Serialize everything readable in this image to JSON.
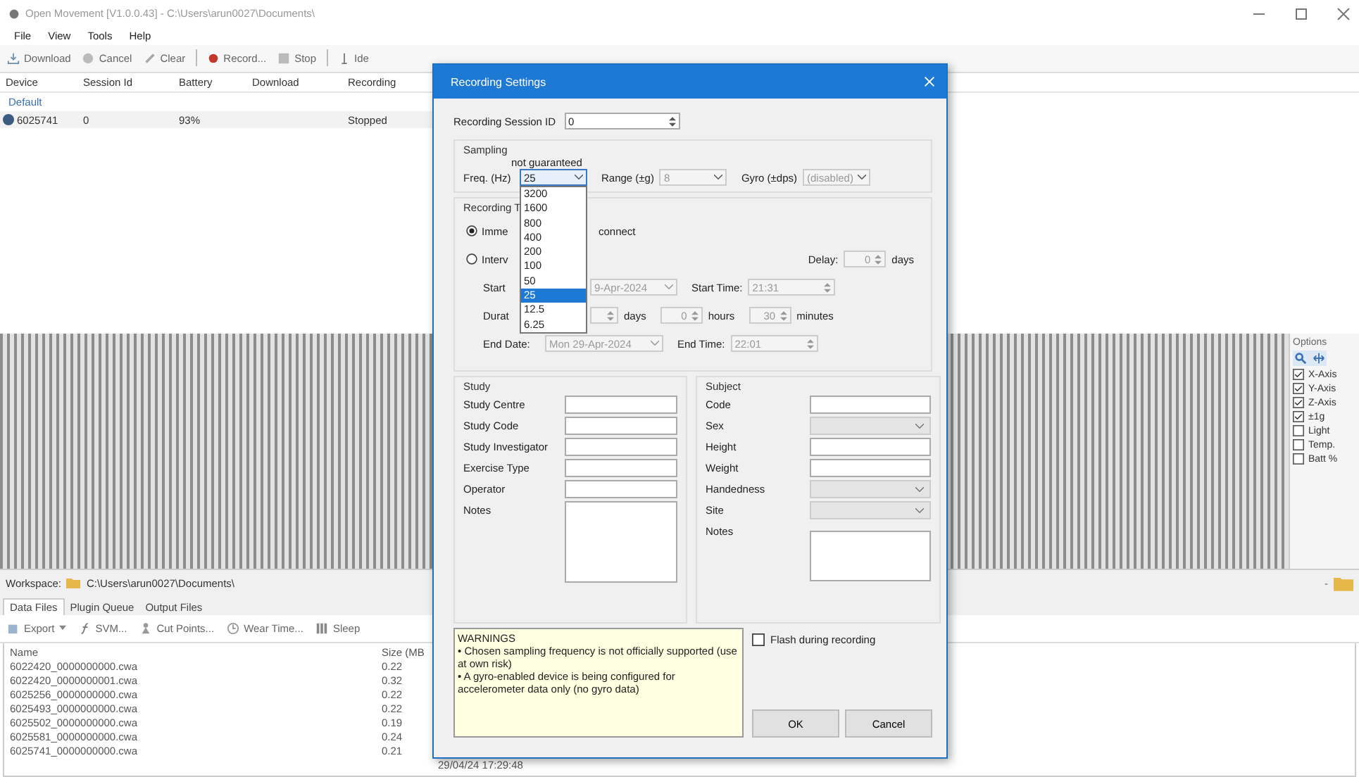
{
  "window": {
    "title": "Open Movement  [V1.0.0.43] - C:\\Users\\arun0027\\Documents\\"
  },
  "menu": [
    "File",
    "View",
    "Tools",
    "Help"
  ],
  "toolbar": [
    {
      "label": "Download"
    },
    {
      "label": "Cancel"
    },
    {
      "label": "Clear"
    },
    {
      "label": "Record..."
    },
    {
      "label": "Stop"
    },
    {
      "label": "Ide"
    }
  ],
  "devices": {
    "columns": [
      "Device",
      "Session Id",
      "Battery",
      "Download",
      "Recording"
    ],
    "group": "Default",
    "rows": [
      {
        "device": "6025741",
        "session": "0",
        "battery": "93%",
        "recording": "Stopped",
        "color": "#3d5a80"
      }
    ]
  },
  "options": {
    "title": "Options",
    "checks": [
      {
        "label": "X-Axis",
        "checked": true
      },
      {
        "label": "Y-Axis",
        "checked": true
      },
      {
        "label": "Z-Axis",
        "checked": true
      },
      {
        "label": "±1g",
        "checked": true
      },
      {
        "label": "Light",
        "checked": false
      },
      {
        "label": "Temp.",
        "checked": false
      },
      {
        "label": "Batt %",
        "checked": false
      }
    ]
  },
  "workspace": {
    "label": "Workspace:",
    "path": "C:\\Users\\arun0027\\Documents\\",
    "minus": "-"
  },
  "tabs": [
    {
      "label": "Data Files",
      "selected": true
    },
    {
      "label": "Plugin Queue",
      "selected": false
    },
    {
      "label": "Output Files",
      "selected": false
    }
  ],
  "file_toolbar": [
    {
      "label": "Export",
      "dropdown": true
    },
    {
      "label": "SVM...",
      "dropdown": false
    },
    {
      "label": "Cut Points...",
      "dropdown": false
    },
    {
      "label": "Wear Time...",
      "dropdown": false
    },
    {
      "label": "Sleep",
      "dropdown": false
    }
  ],
  "files": {
    "columns": [
      "Name",
      "Size (MB"
    ],
    "rows": [
      {
        "name": "6022420_0000000000.cwa",
        "size": "0.22"
      },
      {
        "name": "6022420_0000000001.cwa",
        "size": "0.32"
      },
      {
        "name": "6025256_0000000000.cwa",
        "size": "0.22"
      },
      {
        "name": "6025493_0000000000.cwa",
        "size": "0.22"
      },
      {
        "name": "6025502_0000000000.cwa",
        "size": "0.19"
      },
      {
        "name": "6025581_0000000000.cwa",
        "size": "0.24"
      },
      {
        "name": "6025741_0000000000.cwa",
        "size": "0.21"
      }
    ],
    "trailing_cell": "29/04/24 17:29:48"
  },
  "dialog": {
    "title": "Recording Settings",
    "session_label": "Recording Session ID",
    "session_value": "0",
    "sampling": {
      "title": "Sampling",
      "note": "not guaranteed",
      "freq_label": "Freq. (Hz)",
      "freq_value": "25",
      "freq_options": [
        {
          "label": "3200",
          "selected": false
        },
        {
          "label": "1600",
          "selected": false
        },
        {
          "label": "800",
          "selected": false
        },
        {
          "label": "400",
          "selected": false
        },
        {
          "label": "200",
          "selected": false
        },
        {
          "label": "100",
          "selected": false
        },
        {
          "label": "50",
          "selected": false
        },
        {
          "label": "25",
          "selected": true
        },
        {
          "label": "12.5",
          "selected": false
        },
        {
          "label": "6.25",
          "selected": false
        }
      ],
      "range_label": "Range (±g)",
      "range_value": "8",
      "gyro_label": "Gyro (±dps)",
      "gyro_value": "(disabled)"
    },
    "recording": {
      "title": "Recording T",
      "radios": [
        {
          "label": "Imme",
          "tail": "connect",
          "selected": true
        },
        {
          "label": "Interv",
          "selected": false
        }
      ],
      "delay_label": "Delay:",
      "delay_value": "0",
      "delay_unit": "days",
      "start_label": "Start",
      "start_date": "9-Apr-2024",
      "start_time_label": "Start Time:",
      "start_time": "21:31",
      "duration_label": "Durat",
      "days_unit": "days",
      "hours_value": "0",
      "hours_unit": "hours",
      "minutes_value": "30",
      "minutes_unit": "minutes",
      "end_label": "End Date:",
      "end_date": "Mon 29-Apr-2024",
      "end_time_label": "End Time:",
      "end_time": "22:01"
    },
    "study": {
      "title": "Study",
      "fields": [
        {
          "label": "Study Centre",
          "kind": "text"
        },
        {
          "label": "Study Code",
          "kind": "text"
        },
        {
          "label": "Study Investigator",
          "kind": "text"
        },
        {
          "label": "Exercise Type",
          "kind": "text"
        },
        {
          "label": "Operator",
          "kind": "text"
        },
        {
          "label": "Notes",
          "kind": "area"
        }
      ]
    },
    "subject": {
      "title": "Subject",
      "fields": [
        {
          "label": "Code",
          "kind": "text"
        },
        {
          "label": "Sex",
          "kind": "select"
        },
        {
          "label": "Height",
          "kind": "text"
        },
        {
          "label": "Weight",
          "kind": "text"
        },
        {
          "label": "Handedness",
          "kind": "select"
        },
        {
          "label": "Site",
          "kind": "select"
        },
        {
          "label": "Notes",
          "kind": "area"
        }
      ]
    },
    "warnings": {
      "title": "WARNINGS",
      "lines": [
        "• Chosen sampling frequency is not officially supported (use at own risk)",
        "• A gyro-enabled device is being configured for accelerometer data only (no gyro data)"
      ]
    },
    "flash": {
      "label": "Flash during recording",
      "checked": false
    },
    "buttons": [
      "OK",
      "Cancel"
    ]
  }
}
